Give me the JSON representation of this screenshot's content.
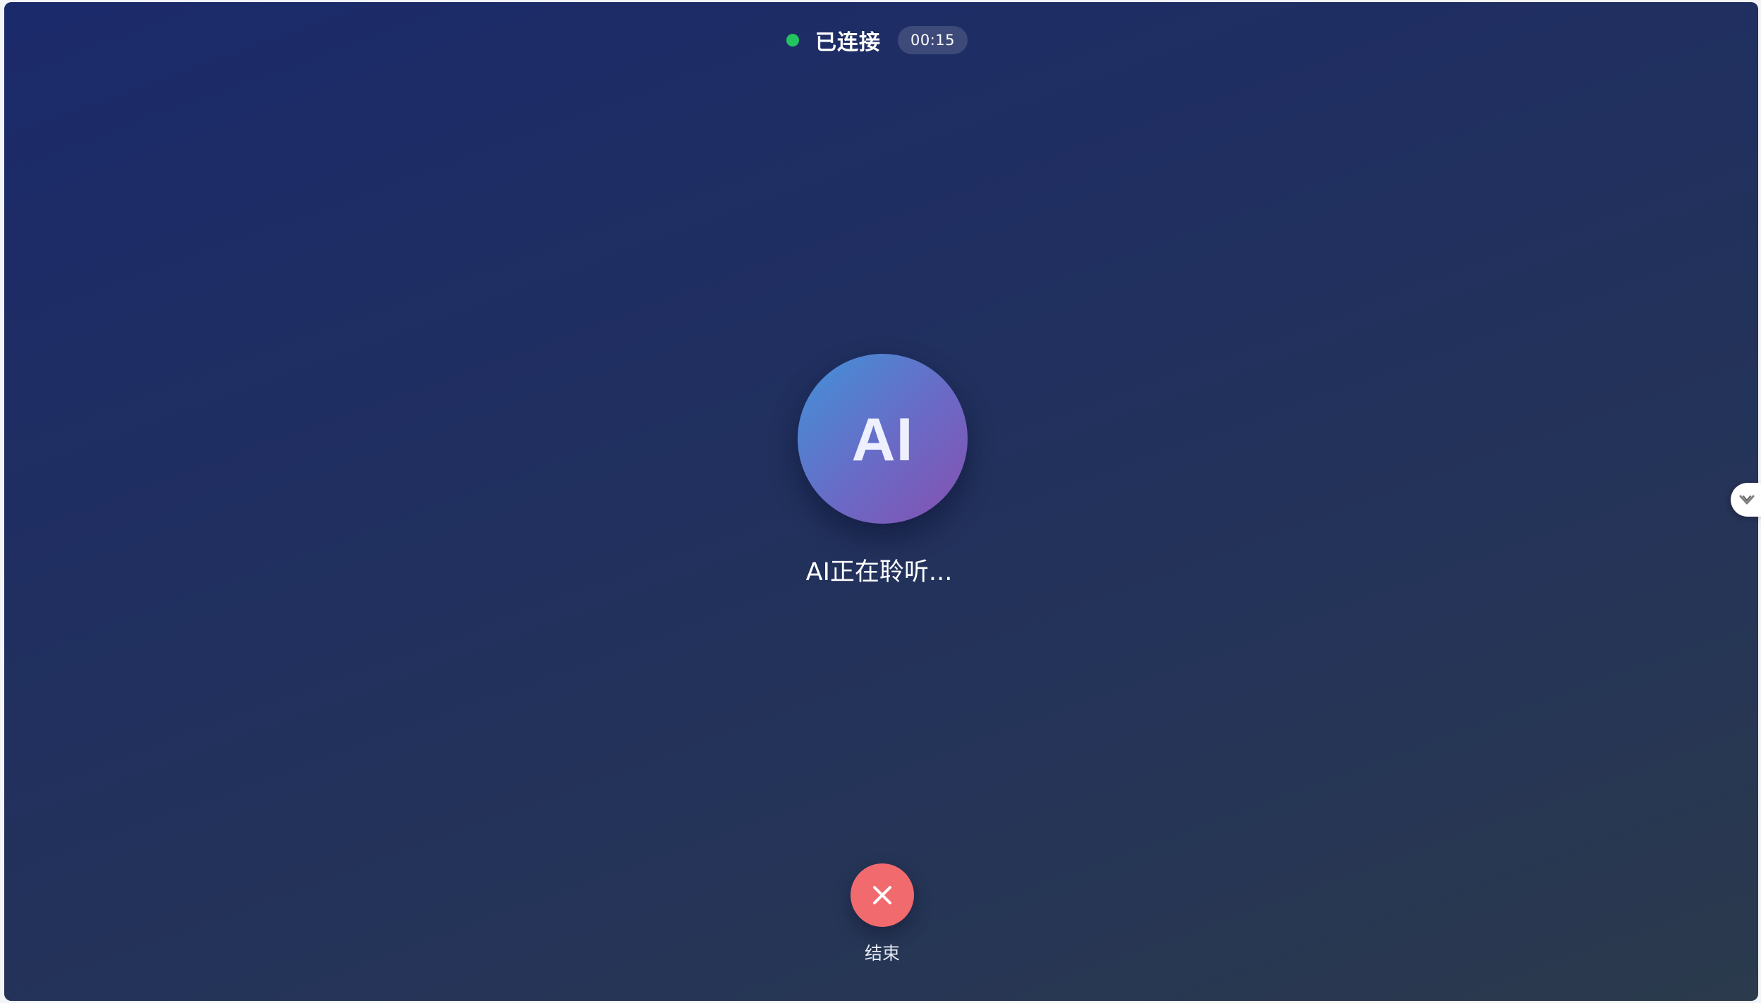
{
  "call": {
    "status_text": "已连接",
    "status_color": "#22c55e",
    "timer": "00:15",
    "avatar_text": "AI",
    "listening_text": "AI正在聆听...",
    "end_label": "结束",
    "end_button_color": "#f16b6e"
  },
  "icons": {
    "status_dot": "status-dot-icon",
    "end_call": "close-icon",
    "side_handle": "chevron-down-icon"
  }
}
